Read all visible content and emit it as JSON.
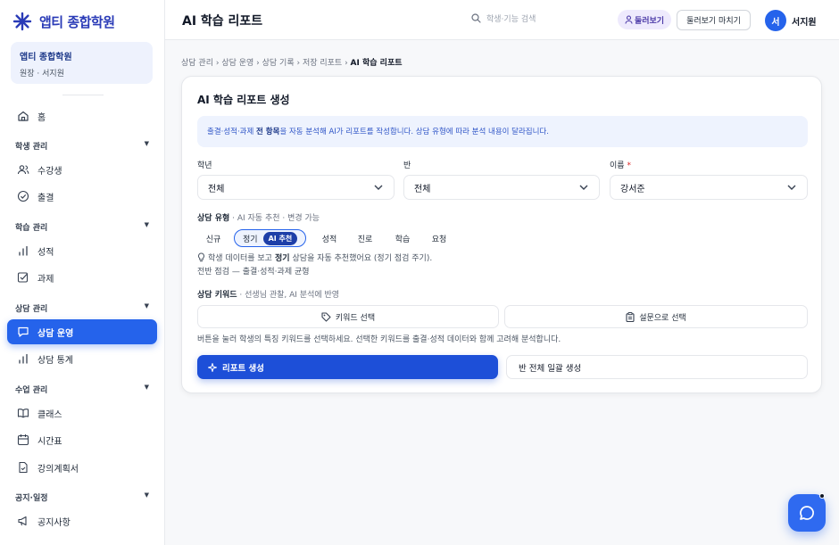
{
  "brand": {
    "name": "앱티 종합학원",
    "accent": "#2563eb"
  },
  "org": {
    "name": "앱티 종합학원",
    "role": "원장 · 서지원"
  },
  "nav": {
    "home": "홈",
    "groups": {
      "students": "학생 관리",
      "learning": "학습 관리",
      "counsel": "상담 관리",
      "classes": "수업 관리",
      "notice": "공지·일정"
    },
    "items": {
      "enrolled": "수강생",
      "attendance": "출결",
      "grades": "성적",
      "assignments": "과제",
      "counsel_ops": "상담 운영",
      "counsel_stats": "상담 통계",
      "class": "클래스",
      "timetable": "시간표",
      "syllabus": "강의계획서",
      "announcement": "공지사항"
    }
  },
  "header": {
    "title": "AI 학습 리포트",
    "search_placeholder": "학생·기능 검색",
    "tour_label": "둘러보기",
    "end_tour_label": "둘러보기 마치기",
    "avatar_initial": "서",
    "user_name": "서지원"
  },
  "breadcrumb": [
    "상담 관리",
    "상담 운영",
    "상담 기록",
    "저장 리포트"
  ],
  "breadcrumb_current": "AI 학습 리포트",
  "form": {
    "title": "AI 학습 리포트 생성",
    "info_pre": "출결·성적·과제 ",
    "info_bold": "전 항목",
    "info_post": "을 자동 분석해 AI가 리포트를 작성합니다. 상담 유형에 따라 분석 내용이 달라집니다.",
    "grade_label": "학년",
    "grade_value": "전체",
    "class_label": "반",
    "class_value": "전체",
    "name_label": "이름",
    "name_required": "*",
    "name_value": "강서준",
    "type_label": "상담 유형",
    "type_sub": " · AI 자동 추천 · 변경 가능",
    "types": [
      "신규",
      "정기",
      "성적",
      "진로",
      "학습",
      "요청"
    ],
    "ai_tag": "AI 추천",
    "hint_pre": "학생 데이터를 보고 ",
    "hint_bold": "정기",
    "hint_post": " 상담을 자동 추천했어요 (정기 점검 주기).",
    "hint_line2": "전반 점검 — 출결·성적·과제 균형",
    "keyword_label": "상담 키워드",
    "keyword_sub": " · 선생님 관찰, AI 분석에 반영",
    "keyword_button": "키워드 선택",
    "survey_button": "설문으로 선택",
    "keyword_hint": "버튼을 눌러 학생의 특징 키워드를 선택하세요. 선택한 키워드를 출결·성적 데이터와 함께 고려해 분석합니다.",
    "generate_button": "리포트 생성",
    "bulk_button": "반 전체 일괄 생성"
  }
}
